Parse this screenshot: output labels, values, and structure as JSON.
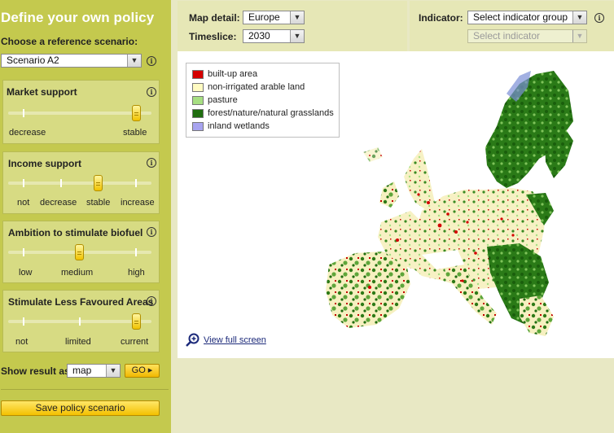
{
  "sidebar": {
    "title": "Define your own policy",
    "reference_label": "Choose a reference scenario:",
    "reference_value": "Scenario A2",
    "panels": [
      {
        "title": "Market support",
        "ticks": [
          "decrease",
          "stable"
        ],
        "selected_index": 1
      },
      {
        "title": "Income support",
        "ticks": [
          "not",
          "decrease",
          "stable",
          "increase"
        ],
        "selected_index": 2
      },
      {
        "title": "Ambition to stimulate biofuel",
        "ticks": [
          "low",
          "medium",
          "high"
        ],
        "selected_index": 1
      },
      {
        "title": "Stimulate Less Favoured Areas",
        "ticks": [
          "not",
          "limited",
          "current"
        ],
        "selected_index": 2
      }
    ],
    "show_result_label": "Show result as",
    "show_result_value": "map",
    "go_label": "GO ▸",
    "save_label": "Save policy scenario"
  },
  "map_controls": {
    "detail_label": "Map detail:",
    "detail_value": "Europe",
    "timeslice_label": "Timeslice:",
    "timeslice_value": "2030"
  },
  "indicator": {
    "label": "Indicator:",
    "group_value": "Select indicator group",
    "indicator_value": "Select indicator"
  },
  "legend": [
    {
      "label": "built-up area",
      "color": "#d40000"
    },
    {
      "label": "non-irrigated arable land",
      "color": "#fffbc2"
    },
    {
      "label": "pasture",
      "color": "#a7df82"
    },
    {
      "label": "forest/nature/natural grasslands",
      "color": "#1f6d0f"
    },
    {
      "label": "inland wetlands",
      "color": "#a8a4f0"
    }
  ],
  "map": {
    "full_screen_label": "View full screen"
  },
  "icons": {
    "info": "info-icon",
    "dropdown": "chevron-down-icon",
    "zoom": "magnifier-plus-icon"
  }
}
